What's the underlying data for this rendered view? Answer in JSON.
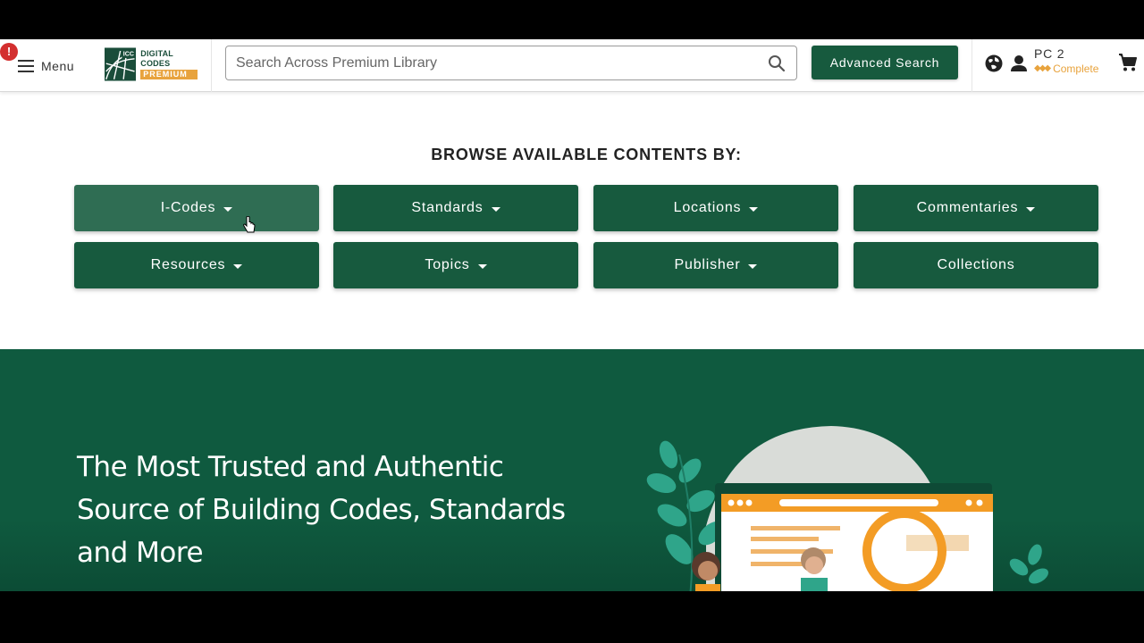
{
  "header": {
    "notification_badge": "!",
    "menu_label": "Menu",
    "logo": {
      "mark": "ICC",
      "line1": "DIGITAL CODES",
      "line2": "PREMIUM"
    },
    "search": {
      "placeholder": "Search Across Premium Library"
    },
    "advanced_search_label": "Advanced Search",
    "account": {
      "name": "PC 2",
      "tier": "Complete"
    }
  },
  "browse": {
    "title": "BROWSE AVAILABLE CONTENTS BY:",
    "categories": [
      {
        "label": "I-Codes",
        "has_dropdown": true
      },
      {
        "label": "Standards",
        "has_dropdown": true
      },
      {
        "label": "Locations",
        "has_dropdown": true
      },
      {
        "label": "Commentaries",
        "has_dropdown": true
      },
      {
        "label": "Resources",
        "has_dropdown": true
      },
      {
        "label": "Topics",
        "has_dropdown": true
      },
      {
        "label": "Publisher",
        "has_dropdown": true
      },
      {
        "label": "Collections",
        "has_dropdown": false
      }
    ]
  },
  "hero": {
    "lines": [
      "The Most Trusted and Authentic",
      "Source of Building Codes, Standards",
      "and More"
    ]
  },
  "colors": {
    "brand_green": "#175a3e",
    "hero_green": "#0f5a3f",
    "accent_orange": "#e8a33d",
    "alert_red": "#d32f2f"
  }
}
